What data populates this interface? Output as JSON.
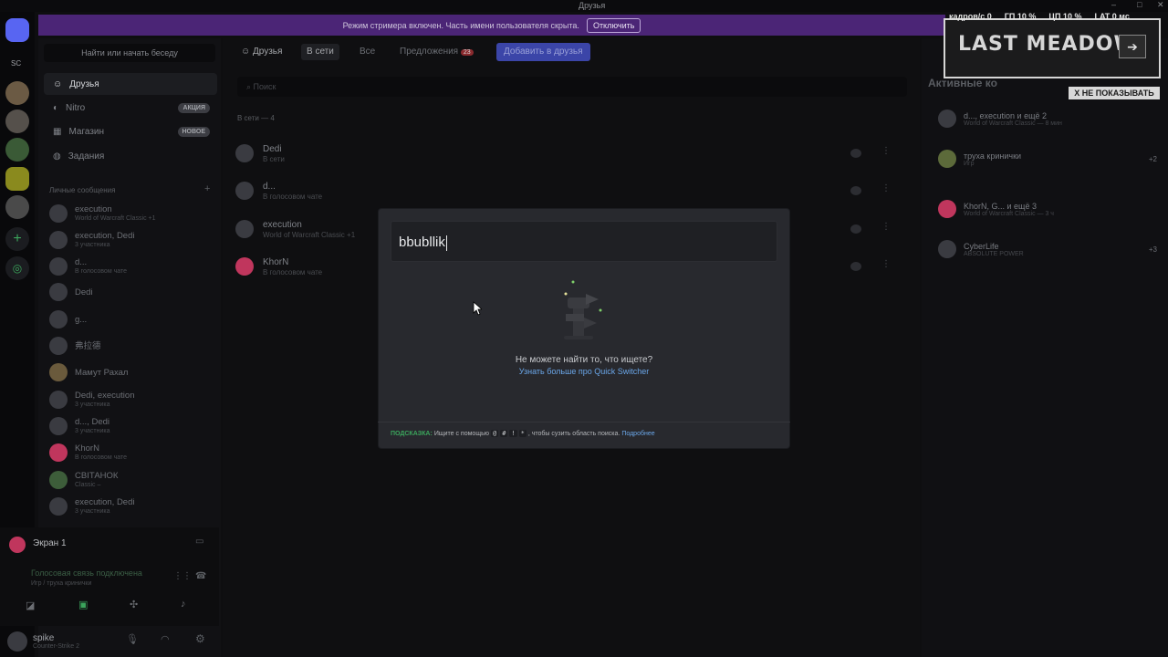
{
  "window_title": "Друзья",
  "streamer_banner": {
    "text": "Режим стримера включен. Часть имени пользователя скрыта.",
    "button": "Отключить"
  },
  "overlay_stats": {
    "fps_label": "кадров/с",
    "fps": "0",
    "gpu": "ГП  10 %",
    "cpu": "ЦП  10 %",
    "lat": "LAT  0 мс"
  },
  "ad": {
    "title": "LAST MEADOW",
    "hide_label": "Х НЕ ПОКАЗЫВАТЬ"
  },
  "sidebar": {
    "search_placeholder": "Найти или начать беседу",
    "nav": [
      {
        "label": "Друзья"
      },
      {
        "label": "Nitro",
        "badge": "АКЦИЯ"
      },
      {
        "label": "Магазин",
        "badge": "НОВОЕ"
      },
      {
        "label": "Задания"
      }
    ],
    "dm_header": "Личные сообщения",
    "dms": [
      {
        "name": "execution",
        "sub": "World of Warcraft Classic +1"
      },
      {
        "name": "execution, Dedi",
        "sub": "3 участника"
      },
      {
        "name": "d...",
        "sub": "В голосовом чате"
      },
      {
        "name": "Dedi",
        "sub": ""
      },
      {
        "name": "g...",
        "sub": ""
      },
      {
        "name": "弗拉德",
        "sub": ""
      },
      {
        "name": "Мамут Рахал",
        "sub": ""
      },
      {
        "name": "Dedi, execution",
        "sub": "3 участника"
      },
      {
        "name": "d..., Dedi",
        "sub": "3 участника"
      },
      {
        "name": "KhorN",
        "sub": "В голосовом чате"
      },
      {
        "name": "СВІТАНОК",
        "sub": "Classic –"
      },
      {
        "name": "execution, Dedi",
        "sub": "3 участника"
      }
    ],
    "screen": "Экран 1",
    "voice_status": "Голосовая связь подключена",
    "voice_sub": "Игр / труха кринички",
    "user_name": "spike",
    "user_status": "Counter-Strike 2",
    "server_label": "SC"
  },
  "main": {
    "tabs": [
      {
        "label": "Друзья"
      },
      {
        "label": "В сети"
      },
      {
        "label": "Все"
      },
      {
        "label": "Предложения",
        "count": "23"
      },
      {
        "label": "Добавить в друзья"
      }
    ],
    "search_placeholder": "Поиск",
    "online_header": "В сети — 4",
    "friends": [
      {
        "name": "Dedi",
        "status": "В сети"
      },
      {
        "name": "d...",
        "status": "В голосовом чате"
      },
      {
        "name": "execution",
        "status": "World of Warcraft Classic +1"
      },
      {
        "name": "KhorN",
        "status": "В голосовом чате"
      }
    ]
  },
  "activity": {
    "title": "Активные ко",
    "items": [
      {
        "name": "d..., execution и ещё 2",
        "sub": "World of Warcraft Classic — 8 мин",
        "extra": ""
      },
      {
        "name": "труха кринички",
        "sub": "Игр",
        "extra": "+2"
      },
      {
        "name": "KhorN, G... и ещё 3",
        "sub": "World of Warcraft Classic — 3 ч",
        "extra": ""
      },
      {
        "name": "CyberLife",
        "sub": "ABSOLUTE POWER",
        "extra": "+3"
      }
    ]
  },
  "quick_switcher": {
    "input_value": "bbubllik",
    "empty_title": "Не можете найти то, что ищете?",
    "empty_link": "Узнать больше про Quick Switcher",
    "tip_label": "ПОДСКАЗКА:",
    "tip_text_1": "Ищите с помощью",
    "tip_keys": [
      "@",
      "#",
      "!",
      "*"
    ],
    "tip_text_2": ", чтобы сузить область поиска.",
    "tip_link": "Подробнее"
  },
  "colors": {
    "accent": "#5865f2",
    "banner": "#4b2576",
    "link": "#6aa6e8",
    "tip": "#3ba55c"
  }
}
